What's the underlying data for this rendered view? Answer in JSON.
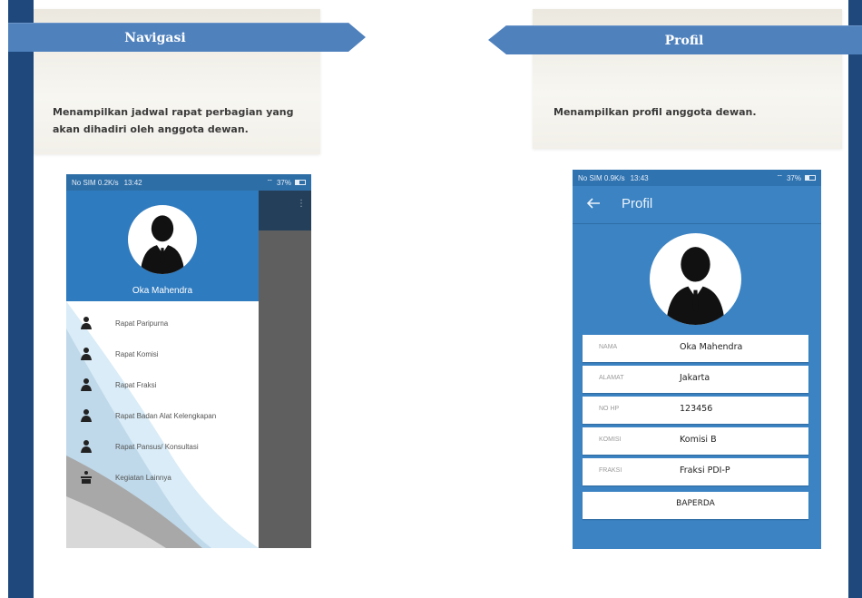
{
  "left_panel": {
    "banner_title": "Navigasi",
    "description": "Menampilkan jadwal rapat perbagian yang akan dihadiri oleh anggota dewan.",
    "phone": {
      "status_left": "No SIM 0.2K/s",
      "status_time": "13:42",
      "status_right": "37%",
      "drawer_user_name": "Oka Mahendra",
      "menu_items": [
        {
          "label": "Rapat Paripurna",
          "icon": "people-icon"
        },
        {
          "label": "Rapat Komisi",
          "icon": "people-icon"
        },
        {
          "label": "Rapat Fraksi",
          "icon": "people-icon"
        },
        {
          "label": "Rapat Badan Alat Kelengkapan",
          "icon": "people-icon"
        },
        {
          "label": "Rapat Pansus/ Konsultasi",
          "icon": "people-icon"
        },
        {
          "label": "Kegiatan Lainnya",
          "icon": "podium-icon"
        }
      ]
    }
  },
  "right_panel": {
    "banner_title": "Profil",
    "description": "Menampilkan profil anggota dewan.",
    "phone": {
      "status_left": "No SIM 0.9K/s",
      "status_time": "13:43",
      "status_right": "37%",
      "toolbar_title": "Profil",
      "fields": [
        {
          "label": "NAMA",
          "value": "Oka Mahendra"
        },
        {
          "label": "ALAMAT",
          "value": "Jakarta"
        },
        {
          "label": "NO HP",
          "value": "123456"
        },
        {
          "label": "KOMISI",
          "value": "Komisi B"
        },
        {
          "label": "FRAKSI",
          "value": "Fraksi PDI-P"
        }
      ],
      "extra_value": "BAPERDA"
    }
  },
  "colors": {
    "edge_bar": "#1f497d",
    "banner": "#4f81bd",
    "app_primary": "#2f7bbf",
    "profile_background": "#3b83c3"
  }
}
